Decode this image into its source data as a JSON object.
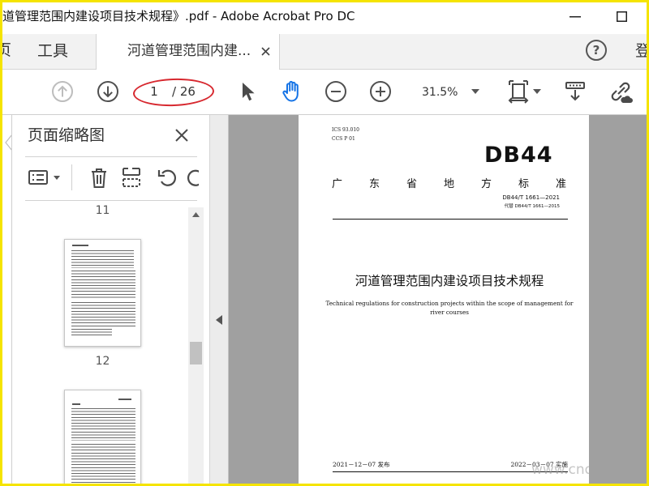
{
  "window": {
    "title": "道管理范围内建设项目技术规程》.pdf - Adobe Acrobat Pro DC",
    "controls": [
      "minimize-icon",
      "maximize-icon"
    ]
  },
  "tabbar": {
    "home_label": "页",
    "tools_label": "工具",
    "document_tab_label": "河道管理范围内建...",
    "help_label": "?",
    "signin_label": "登"
  },
  "toolbar": {
    "page_current": "1",
    "page_total": "/ 26",
    "zoom": "31.5%",
    "icons": {
      "previous_page": "up-arrow-circle-icon",
      "next_page": "down-arrow-circle-icon",
      "select_tool": "cursor-arrow-icon",
      "hand_tool": "hand-icon",
      "zoom_out": "minus-circle-icon",
      "zoom_in": "plus-circle-icon",
      "page_fit": "fit-page-icon",
      "scroll_mode": "scroll-mode-icon",
      "share_link": "link-cloud-icon"
    }
  },
  "thumbnails_panel": {
    "title": "页面缩略图",
    "page_labels": [
      "11",
      "12"
    ],
    "icons": {
      "options": "options-menu-icon",
      "delete": "trash-icon",
      "insert": "insert-pages-icon",
      "rotate_ccw": "rotate-counterclockwise-icon",
      "rotate_cw": "rotate-clockwise-icon",
      "close": "close-icon"
    }
  },
  "document": {
    "ics": "ICS 93.010",
    "ccs": "CCS P 01",
    "logo": "DB44",
    "issuer": "广东省地方标准",
    "standard_number": "DB44/T 1661—2021",
    "replaces": "代替 DB44/T 1661—2015",
    "title_cn": "河道管理范围内建设项目技术规程",
    "title_en_lines": [
      "Technical regulations for construction projects within the scope of management for",
      "river courses"
    ],
    "issue_date": "2021－12－07 发布",
    "effective_date": "2022－03－07 实施"
  },
  "watermark": "www.cnd",
  "colors": {
    "frame": "#f5e400",
    "accent": "#1473e6",
    "annotation": "#d7282f",
    "canvas": "#a0a0a0"
  }
}
